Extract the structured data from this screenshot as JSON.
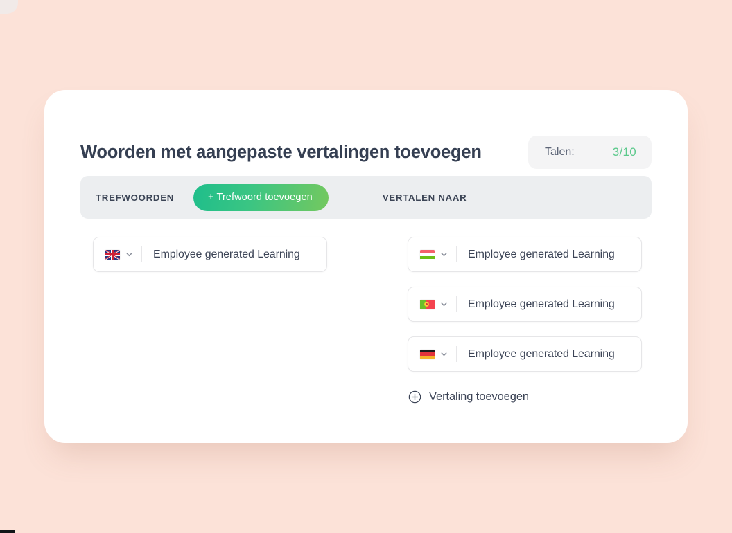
{
  "theme": {
    "page_background": "#fce2d8",
    "card_background": "#ffffff",
    "accent_green": "#3ac583",
    "count_green": "#5cc98c",
    "text_dark": "#3c4456",
    "tabbar_background": "#eceef0"
  },
  "header": {
    "title": "Woorden met aangepaste vertalingen toevoegen",
    "badge": {
      "label": "Talen:",
      "count": "3/10"
    }
  },
  "tabs": {
    "keywords_label": "TREFWOORDEN",
    "add_keyword_button": "+ Trefwoord toevoegen",
    "translate_to_label": "VERTALEN NAAR"
  },
  "source": {
    "rows": [
      {
        "flag": "flag-gb",
        "flag_name": "united-kingdom-flag-icon",
        "chevron": "chevron-down-icon",
        "value": "Employee generated Learning"
      }
    ]
  },
  "translations": {
    "rows": [
      {
        "flag": "flag-hu",
        "flag_name": "hungary-flag-icon",
        "chevron": "chevron-down-icon",
        "value": "Employee generated Learning"
      },
      {
        "flag": "flag-pt",
        "flag_name": "portugal-flag-icon",
        "chevron": "chevron-down-icon",
        "value": "Employee generated Learning"
      },
      {
        "flag": "flag-de",
        "flag_name": "germany-flag-icon",
        "chevron": "chevron-down-icon",
        "value": "Employee generated Learning"
      }
    ],
    "add_link": {
      "icon": "plus-circle-icon",
      "label": "Vertaling toevoegen"
    }
  }
}
